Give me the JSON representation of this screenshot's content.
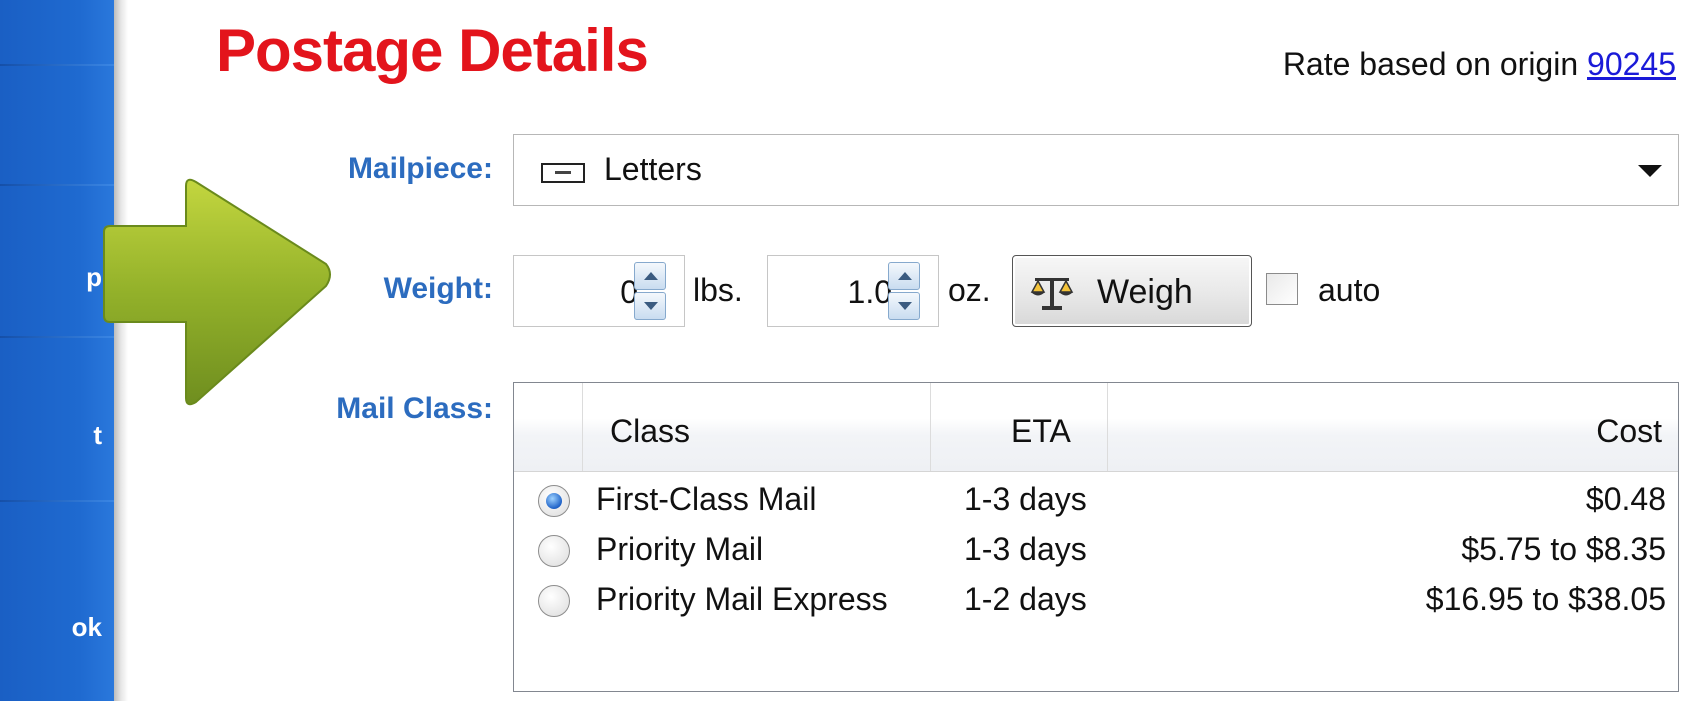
{
  "sidebar": {
    "fragments": [
      "p",
      "t",
      "ok"
    ]
  },
  "header": {
    "title": "Postage Details",
    "rate_text": "Rate based on origin",
    "origin_zip": "90245"
  },
  "mailpiece": {
    "label": "Mailpiece:",
    "value": "Letters",
    "icon": "envelope-icon"
  },
  "weight": {
    "label": "Weight:",
    "lbs_value": "0",
    "lbs_unit": "lbs.",
    "oz_value": "1.0",
    "oz_unit": "oz.",
    "weigh_button": "Weigh",
    "auto_label": "auto",
    "auto_checked": false
  },
  "mail_class": {
    "label": "Mail Class:",
    "columns": [
      "Class",
      "ETA",
      "Cost"
    ],
    "rows": [
      {
        "class": "First-Class Mail",
        "eta": "1-3 days",
        "cost": "$0.48",
        "selected": true
      },
      {
        "class": "Priority Mail",
        "eta": "1-3 days",
        "cost": "$5.75 to $8.35",
        "selected": false
      },
      {
        "class": "Priority Mail Express",
        "eta": "1-2 days",
        "cost": "$16.95 to $38.05",
        "selected": false
      }
    ]
  },
  "colors": {
    "title": "#e3141c",
    "label": "#2c6cbf",
    "sidebar": "#1f6ad0",
    "arrow": "#8fae2a",
    "link": "#1a1ad8"
  }
}
